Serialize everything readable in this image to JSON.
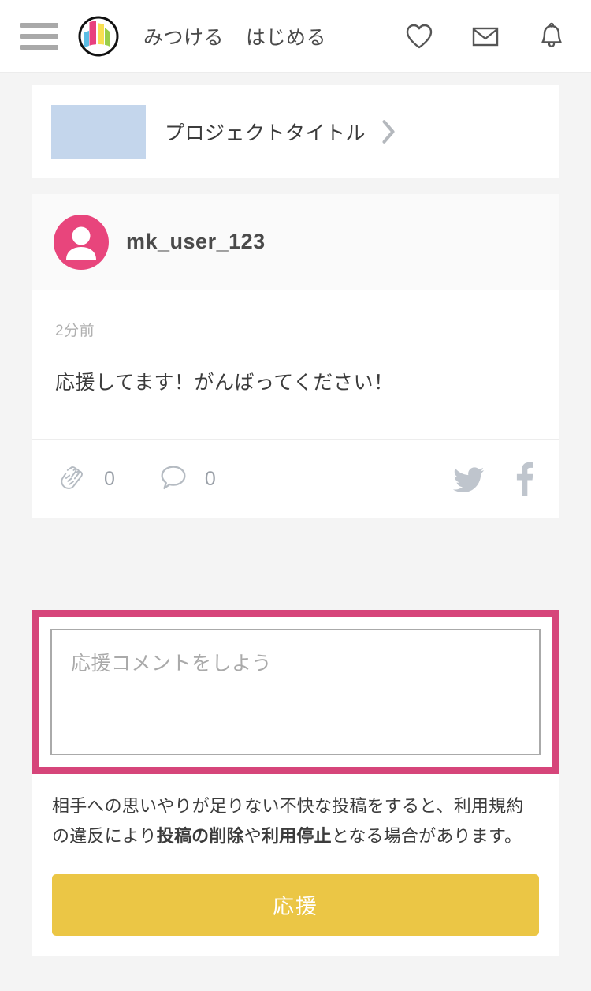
{
  "header": {
    "menu_icon": "hamburger-menu-icon",
    "logo_icon": "makuake-logo-icon",
    "nav": [
      {
        "label": "みつける"
      },
      {
        "label": "はじめる"
      }
    ],
    "icons": [
      {
        "name": "heart-icon"
      },
      {
        "name": "envelope-icon"
      },
      {
        "name": "bell-icon"
      }
    ]
  },
  "project_card": {
    "thumbnail_color": "#c4d6ec",
    "title": "プロジェクトタイトル",
    "chevron_icon": "chevron-right-icon"
  },
  "post": {
    "avatar_icon": "user-avatar-icon",
    "avatar_color": "#e8457c",
    "username": "mk_user_123",
    "time": "2分前",
    "text": "応援してます！がんばってください！",
    "actions": {
      "clap": {
        "icon": "clap-icon",
        "count": "0"
      },
      "comment": {
        "icon": "comment-bubble-icon",
        "count": "0"
      }
    },
    "share": [
      {
        "name": "twitter-icon"
      },
      {
        "name": "facebook-icon"
      }
    ]
  },
  "comment_form": {
    "placeholder": "応援コメントをしよう",
    "value": "",
    "focus_border_color": "#d6457a",
    "notice": {
      "part1": "相手への思いやりが足りない不快な投稿をすると、利用規約の違反により",
      "bold1": "投稿の削除",
      "part2": "や",
      "bold2": "利用停止",
      "part3": "となる場合があります。"
    },
    "submit_label": "応援",
    "submit_color": "#ebc645"
  }
}
